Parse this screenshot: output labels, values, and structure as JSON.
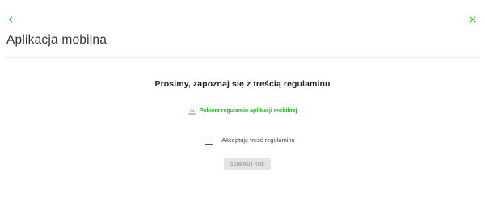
{
  "header": {
    "title": "Aplikacja mobilna",
    "back_icon": "chevron-left-icon",
    "close_icon": "close-icon"
  },
  "main": {
    "heading": "Prosimy, zapoznaj się z treścią regulaminu",
    "download": {
      "label": "Pobierz regulamin aplikacji mobilnej",
      "icon": "download-icon"
    },
    "accept": {
      "label": "Akceptuję treść regulaminu",
      "checked": false
    },
    "generate_button": {
      "label": "GENERUJ KOD",
      "enabled": false
    }
  },
  "colors": {
    "accent": "#2bb02b",
    "button_disabled_bg": "#e4e4e4",
    "button_disabled_text": "#9a9a9a"
  }
}
